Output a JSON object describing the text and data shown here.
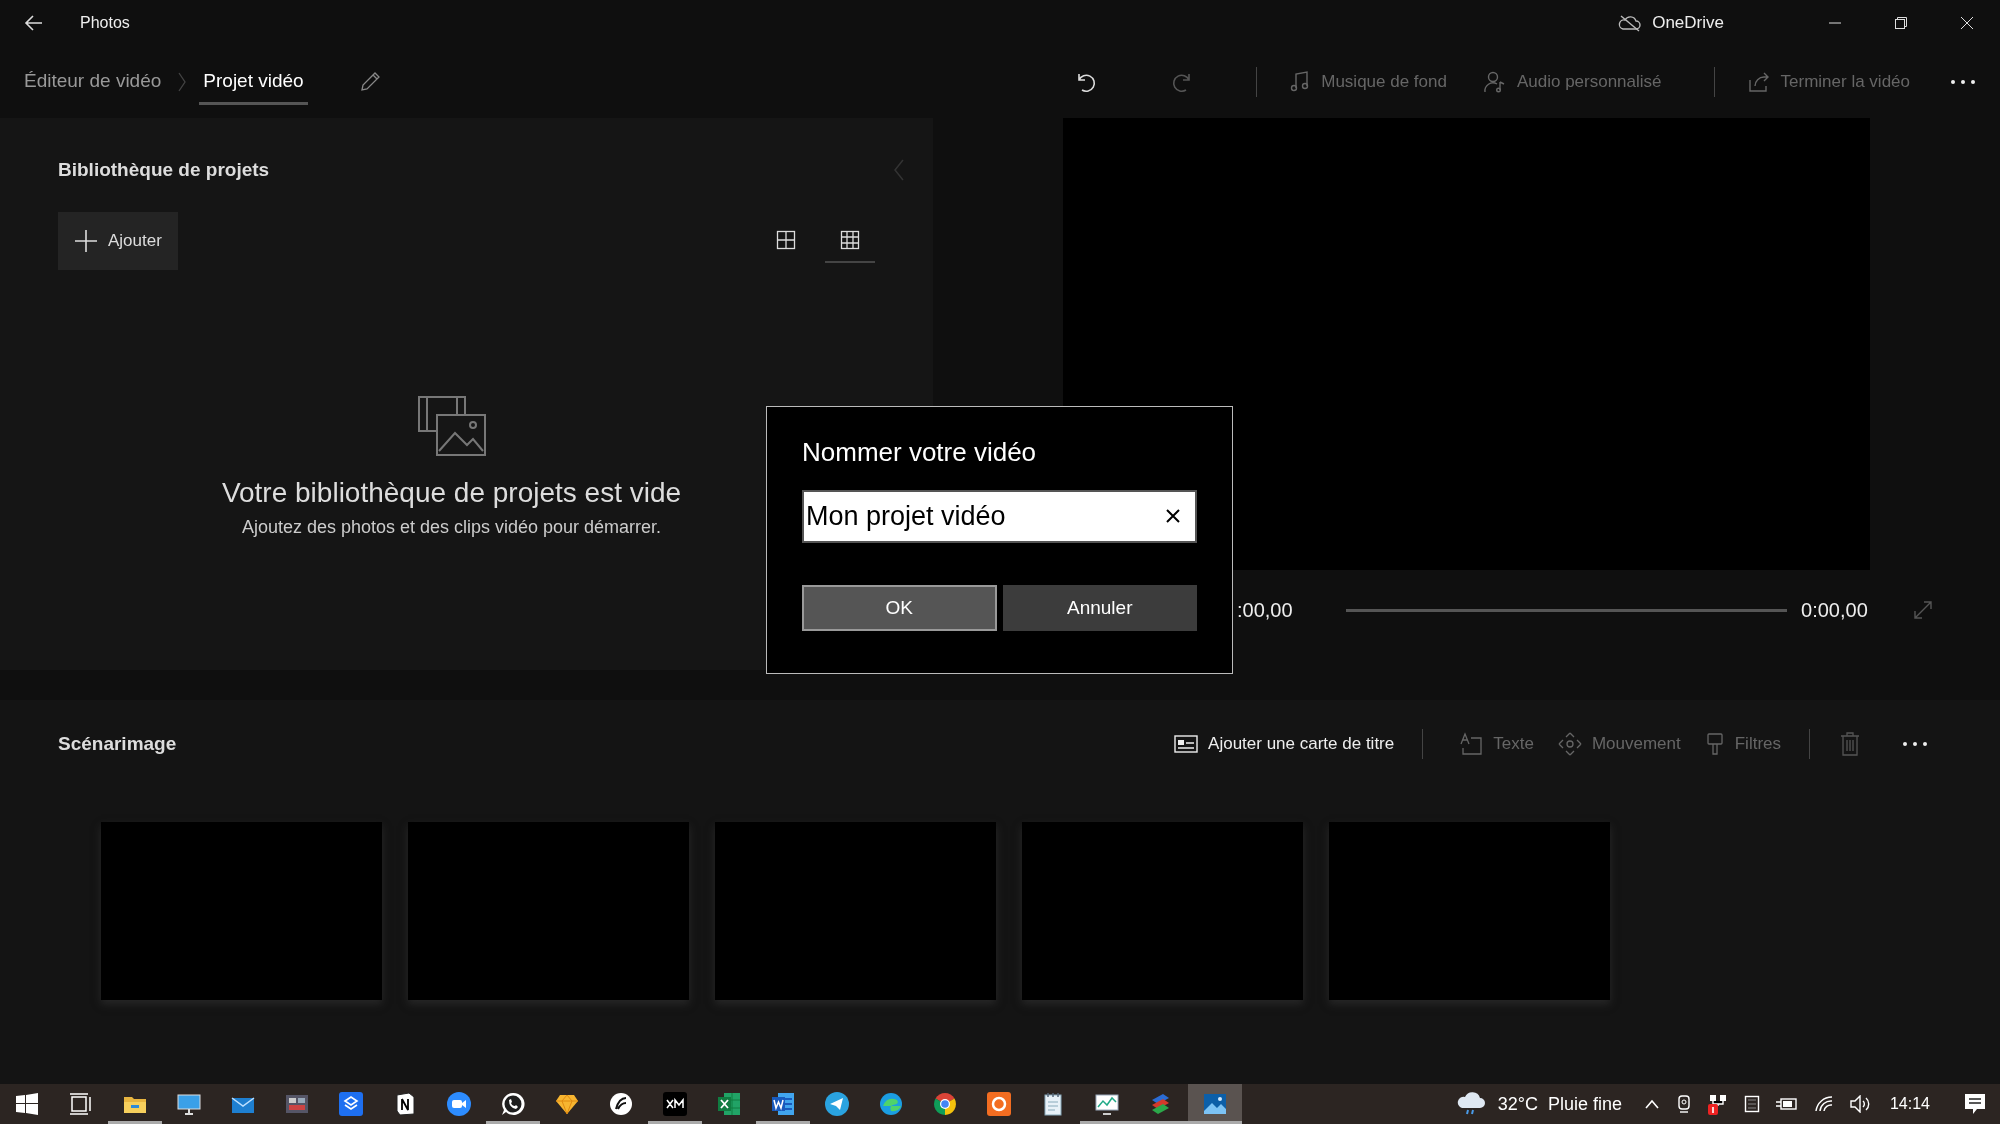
{
  "window": {
    "title": "Photos",
    "account": "OneDrive"
  },
  "breadcrumb": [
    {
      "label": "Éditeur de vidéo",
      "selected": false
    },
    {
      "label": "Projet vidéo",
      "selected": true
    }
  ],
  "history": {
    "undo_disabled": false,
    "redo_disabled": true
  },
  "toolbar": [
    {
      "kind": "music",
      "label": "Musique de fond",
      "disabled": true
    },
    {
      "kind": "audio",
      "label": "Audio personnalisé",
      "disabled": true
    },
    {
      "kind": "share",
      "label": "Terminer la vidéo",
      "disabled": true
    }
  ],
  "library": {
    "title": "Bibliothèque de projets",
    "add_button": "Ajouter",
    "view_modes": [
      {
        "kind": "large",
        "selected": false
      },
      {
        "kind": "small",
        "selected": true
      }
    ],
    "empty_title": "Votre bibliothèque de projets est vide",
    "empty_text": "Ajoutez des photos et des clips vidéo pour démarrer."
  },
  "player": {
    "current_time": ":00,00",
    "total_time": "0:00,00",
    "level": 0
  },
  "storyboard": {
    "title": "Scénarimage",
    "actions": [
      {
        "kind": "title-card",
        "label": "Ajouter une carte de titre",
        "disabled": false
      },
      {
        "kind": "text",
        "label": "Texte",
        "disabled": true
      },
      {
        "kind": "motion",
        "label": "Mouvement",
        "disabled": true
      },
      {
        "kind": "filters",
        "label": "Filtres",
        "disabled": true
      }
    ],
    "delete_disabled": true,
    "slots": [
      {
        "filled": false
      },
      {
        "filled": false
      },
      {
        "filled": false
      },
      {
        "filled": false
      },
      {
        "filled": false
      }
    ]
  },
  "dialog": {
    "title": "Nommer votre vidéo",
    "value": "Mon projet vidéo",
    "buttons": [
      {
        "label": "OK",
        "selected": true
      },
      {
        "label": "Annuler",
        "selected": false
      }
    ]
  },
  "taskbar": {
    "apps": [
      {
        "kind": "start",
        "running": false,
        "selected": false
      },
      {
        "kind": "taskview",
        "running": false,
        "selected": false
      },
      {
        "kind": "folder",
        "running": true,
        "selected": false
      },
      {
        "kind": "monitor",
        "running": false,
        "selected": false
      },
      {
        "kind": "mail",
        "running": false,
        "selected": false
      },
      {
        "kind": "film",
        "running": false,
        "selected": false
      },
      {
        "kind": "box",
        "running": false,
        "selected": false
      },
      {
        "kind": "notebook",
        "running": false,
        "selected": false
      },
      {
        "kind": "camera",
        "running": false,
        "selected": false
      },
      {
        "kind": "phone",
        "running": true,
        "selected": false
      },
      {
        "kind": "diamond",
        "running": false,
        "selected": false
      },
      {
        "kind": "swirl",
        "running": false,
        "selected": false
      },
      {
        "kind": "darktile",
        "running": true,
        "selected": false
      },
      {
        "kind": "sheet",
        "running": false,
        "selected": false
      },
      {
        "kind": "doc",
        "running": true,
        "selected": false
      },
      {
        "kind": "plane",
        "running": false,
        "selected": false
      },
      {
        "kind": "wave",
        "running": false,
        "selected": false
      },
      {
        "kind": "ring",
        "running": false,
        "selected": false
      },
      {
        "kind": "orange",
        "running": false,
        "selected": false
      },
      {
        "kind": "notepad",
        "running": false,
        "selected": false
      },
      {
        "kind": "chart",
        "running": true,
        "selected": false
      },
      {
        "kind": "books",
        "running": true,
        "selected": false
      },
      {
        "kind": "landscape",
        "running": true,
        "selected": true
      }
    ],
    "temperature": "32°C",
    "condition": "Pluie fine",
    "clock": "14:14"
  }
}
